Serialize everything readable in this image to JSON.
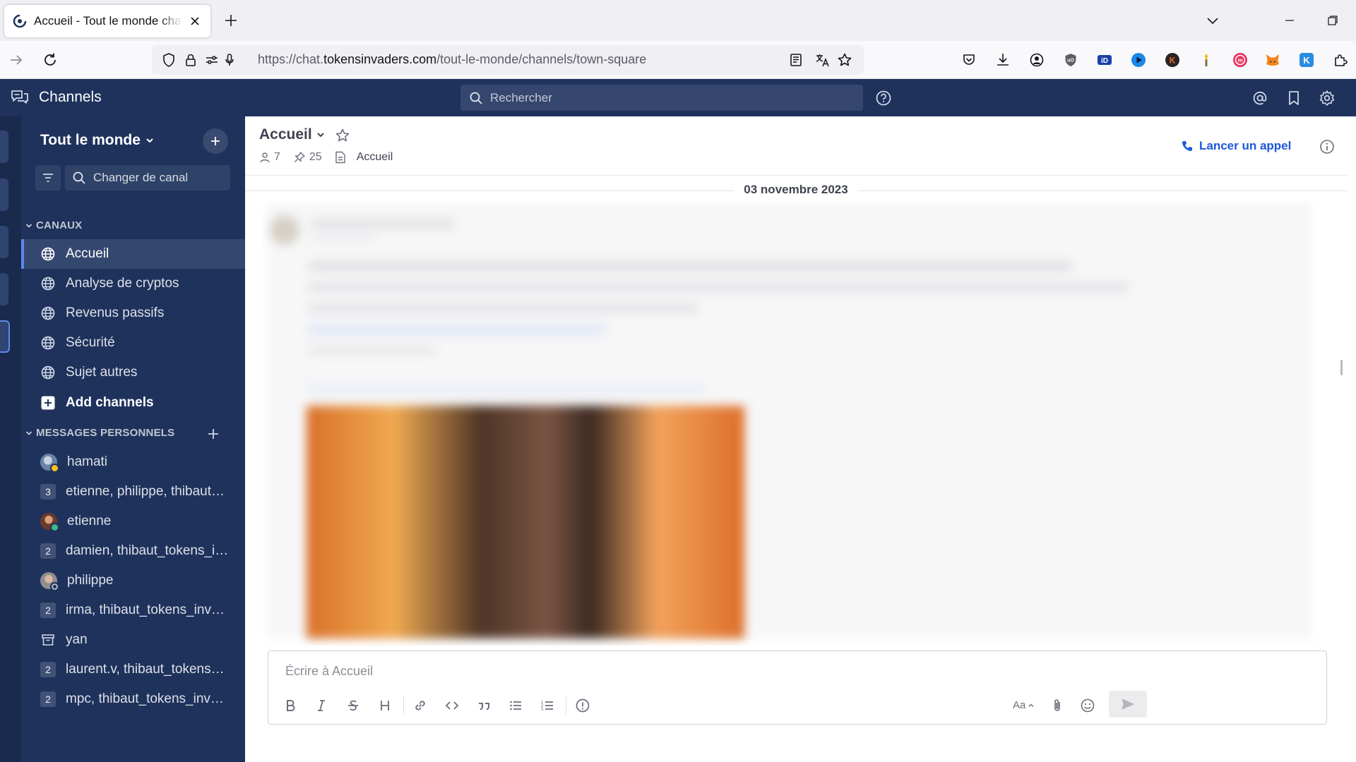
{
  "browser": {
    "tab_title": "Accueil - Tout le monde chat.tokensinvaders.com",
    "url_prefix": "https://chat.",
    "url_host": "tokensinvaders.com",
    "url_path": "/tout-le-monde/channels/town-square"
  },
  "app": {
    "name": "Channels",
    "search_placeholder": "Rechercher"
  },
  "sidebar": {
    "team_name": "Tout le monde",
    "switcher_placeholder": "Changer de canal",
    "channels_header": "CANAUX",
    "channels": [
      {
        "label": "Accueil",
        "active": true
      },
      {
        "label": "Analyse de cryptos"
      },
      {
        "label": "Revenus passifs"
      },
      {
        "label": "Sécurité"
      },
      {
        "label": "Sujet autres"
      }
    ],
    "add_channels": "Add channels",
    "dm_header": "MESSAGES PERSONNELS",
    "dms": [
      {
        "label": "hamati",
        "kind": "avatar",
        "status": "away"
      },
      {
        "label": "etienne, philippe, thibaut_tokens_invaders",
        "kind": "group",
        "count": "3"
      },
      {
        "label": "etienne",
        "kind": "avatar",
        "status": "online"
      },
      {
        "label": "damien, thibaut_tokens_invaders",
        "kind": "group",
        "count": "2"
      },
      {
        "label": "philippe",
        "kind": "avatar",
        "status": "offline"
      },
      {
        "label": "irma, thibaut_tokens_invaders",
        "kind": "group",
        "count": "2"
      },
      {
        "label": "yan",
        "kind": "archived"
      },
      {
        "label": "laurent.v, thibaut_tokens_invaders",
        "kind": "group",
        "count": "2"
      },
      {
        "label": "mpc, thibaut_tokens_invaders",
        "kind": "group",
        "count": "2"
      }
    ]
  },
  "channel": {
    "title": "Accueil",
    "members": "7",
    "pinned": "25",
    "header_text": "Accueil",
    "call_label": "Lancer un appel",
    "date_separator": "03 novembre 2023"
  },
  "composer": {
    "placeholder": "Écrire à Accueil",
    "format_label": "Aa"
  },
  "colors": {
    "sidebar_bg": "#1e325c",
    "accent": "#1c58d9",
    "active_item": "#34486f"
  }
}
